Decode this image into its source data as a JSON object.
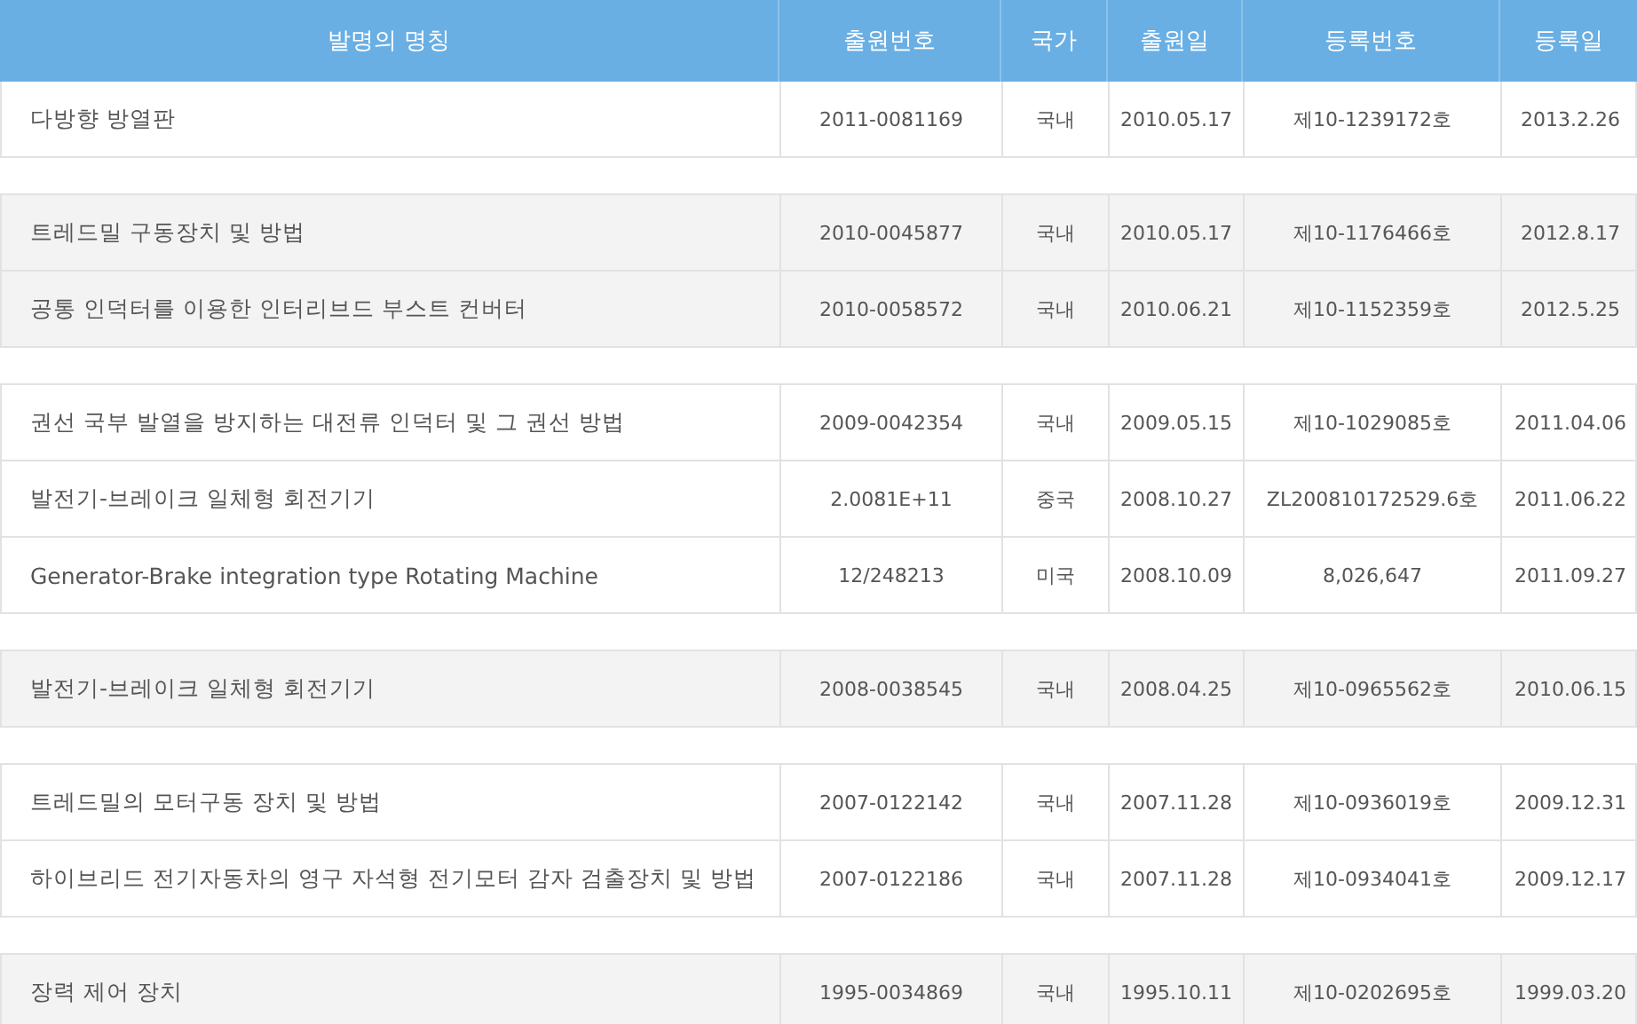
{
  "table": {
    "columns": [
      "발명의 명칭",
      "출원번호",
      "국가",
      "출원일",
      "등록번호",
      "등록일"
    ],
    "groups": [
      {
        "shaded": false,
        "rows": [
          [
            "다방향 방열판",
            "2011-0081169",
            "국내",
            "2010.05.17",
            "제10-1239172호",
            "2013.2.26"
          ]
        ]
      },
      {
        "shaded": true,
        "rows": [
          [
            "트레드밀 구동장치 및 방법",
            "2010-0045877",
            "국내",
            "2010.05.17",
            "제10-1176466호",
            "2012.8.17"
          ],
          [
            "공통 인덕터를 이용한 인터리브드 부스트 컨버터",
            "2010-0058572",
            "국내",
            "2010.06.21",
            "제10-1152359호",
            "2012.5.25"
          ]
        ]
      },
      {
        "shaded": false,
        "rows": [
          [
            "권선 국부 발열을 방지하는 대전류 인덕터 및 그 권선 방법",
            "2009-0042354",
            "국내",
            "2009.05.15",
            "제10-1029085호",
            "2011.04.06"
          ],
          [
            "발전기-브레이크 일체형 회전기기",
            "2.0081E+11",
            "중국",
            "2008.10.27",
            "ZL200810172529.6호",
            "2011.06.22"
          ],
          [
            "Generator-Brake integration type Rotating Machine",
            "12/248213",
            "미국",
            "2008.10.09",
            "8,026,647",
            "2011.09.27"
          ]
        ]
      },
      {
        "shaded": true,
        "rows": [
          [
            "발전기-브레이크 일체형 회전기기",
            "2008-0038545",
            "국내",
            "2008.04.25",
            "제10-0965562호",
            "2010.06.15"
          ]
        ]
      },
      {
        "shaded": false,
        "rows": [
          [
            "트레드밀의 모터구동 장치 및 방법",
            "2007-0122142",
            "국내",
            "2007.11.28",
            "제10-0936019호",
            "2009.12.31"
          ],
          [
            "하이브리드 전기자동차의 영구 자석형 전기모터 감자 검출장치 및 방법",
            "2007-0122186",
            "국내",
            "2007.11.28",
            "제10-0934041호",
            "2009.12.17"
          ]
        ]
      },
      {
        "shaded": true,
        "rows": [
          [
            "장력 제어 장치",
            "1995-0034869",
            "국내",
            "1995.10.11",
            "제10-0202695호",
            "1999.03.20"
          ]
        ]
      }
    ]
  }
}
